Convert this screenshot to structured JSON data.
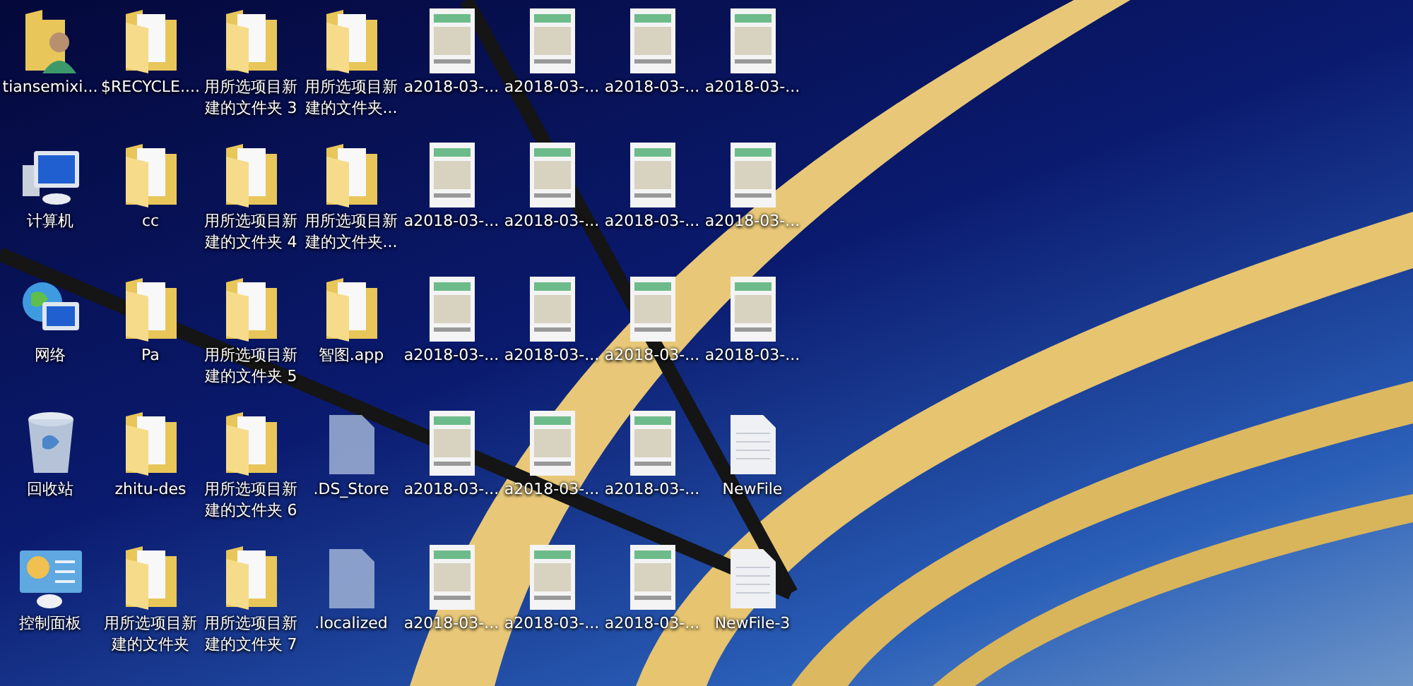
{
  "desktop": {
    "icons": [
      {
        "kind": "user",
        "label": "tiansemixi..."
      },
      {
        "kind": "computer",
        "label": "计算机"
      },
      {
        "kind": "network",
        "label": "网络"
      },
      {
        "kind": "recycle",
        "label": "回收站"
      },
      {
        "kind": "control",
        "label": "控制面板"
      },
      {
        "kind": "folder",
        "label": "$RECYCLE...."
      },
      {
        "kind": "folder",
        "label": "cc"
      },
      {
        "kind": "folder",
        "label": "Pa"
      },
      {
        "kind": "folder",
        "label": "zhitu-des"
      },
      {
        "kind": "folder",
        "label": "用所选项目新建的文件夹"
      },
      {
        "kind": "folder",
        "label": "用所选项目新建的文件夹 3"
      },
      {
        "kind": "folder",
        "label": "用所选项目新建的文件夹 4"
      },
      {
        "kind": "folder",
        "label": "用所选项目新建的文件夹 5"
      },
      {
        "kind": "folder",
        "label": "用所选项目新建的文件夹 6"
      },
      {
        "kind": "folder",
        "label": "用所选项目新建的文件夹 7"
      },
      {
        "kind": "folder",
        "label": "用所选项目新建的文件夹..."
      },
      {
        "kind": "folder",
        "label": "用所选项目新建的文件夹..."
      },
      {
        "kind": "folder",
        "label": "智图.app"
      },
      {
        "kind": "file",
        "label": ".DS_Store"
      },
      {
        "kind": "file",
        "label": ".localized"
      },
      {
        "kind": "image",
        "label": "a2018-03-..."
      },
      {
        "kind": "image",
        "label": "a2018-03-..."
      },
      {
        "kind": "image",
        "label": "a2018-03-..."
      },
      {
        "kind": "image",
        "label": "a2018-03-..."
      },
      {
        "kind": "image",
        "label": "a2018-03-..."
      },
      {
        "kind": "image",
        "label": "a2018-03-..."
      },
      {
        "kind": "image",
        "label": "a2018-03-..."
      },
      {
        "kind": "image",
        "label": "a2018-03-..."
      },
      {
        "kind": "image",
        "label": "a2018-03-..."
      },
      {
        "kind": "image",
        "label": "a2018-03-..."
      },
      {
        "kind": "image",
        "label": "a2018-03-..."
      },
      {
        "kind": "image",
        "label": "a2018-03-..."
      },
      {
        "kind": "image",
        "label": "a2018-03-..."
      },
      {
        "kind": "image",
        "label": "a2018-03-..."
      },
      {
        "kind": "image",
        "label": "a2018-03-..."
      },
      {
        "kind": "image",
        "label": "a2018-03-..."
      },
      {
        "kind": "image",
        "label": "a2018-03-..."
      },
      {
        "kind": "image",
        "label": "a2018-03-..."
      },
      {
        "kind": "textfile",
        "label": "NewFile"
      },
      {
        "kind": "textfile",
        "label": "NewFile-3"
      }
    ]
  }
}
